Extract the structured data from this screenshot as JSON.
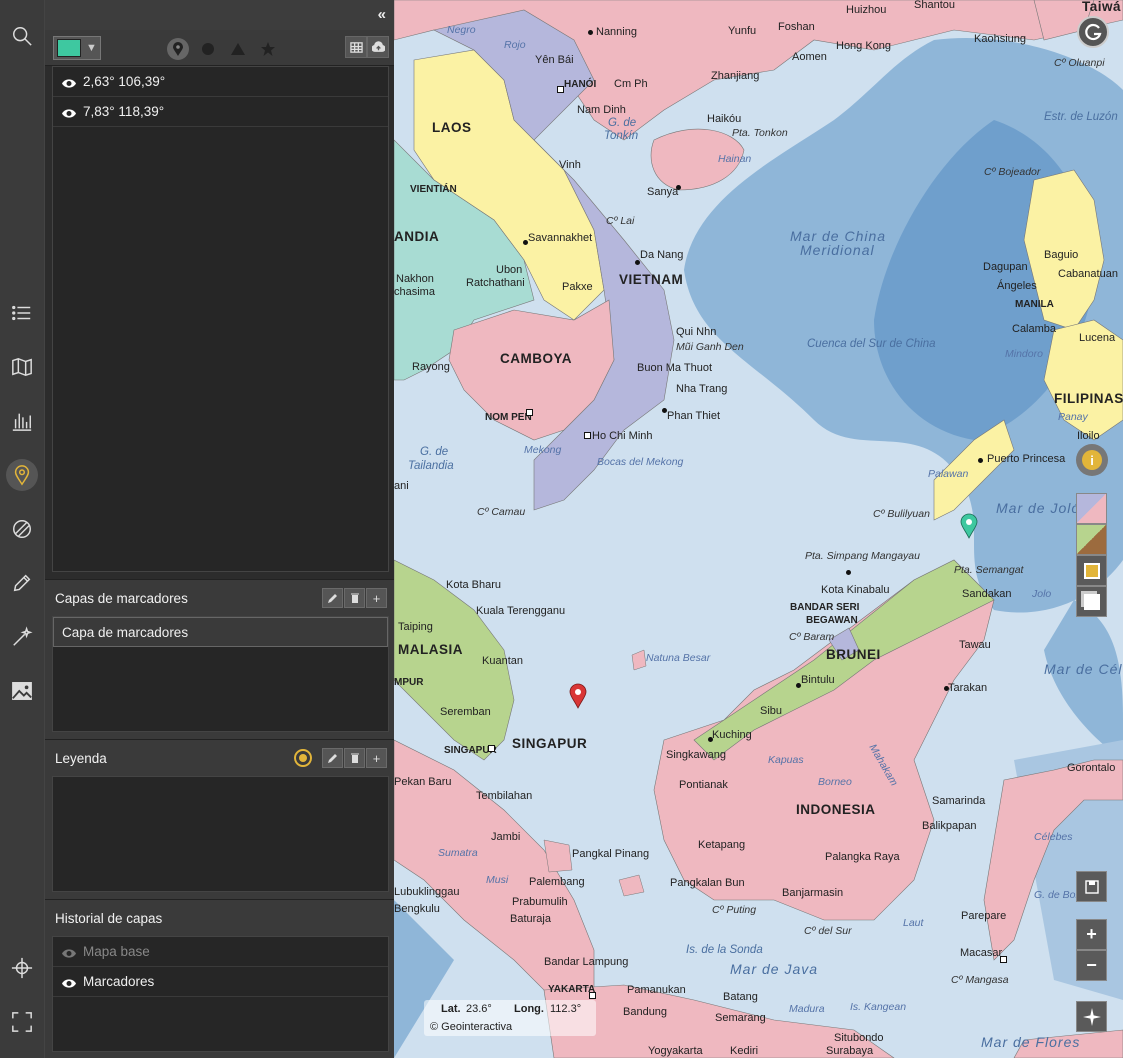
{
  "rail": {
    "icons": [
      "search-icon",
      "list-icon",
      "map-book-icon",
      "chart-bars-icon",
      "map-pin-icon",
      "compass-ruler-icon",
      "pencil-icon",
      "magic-wand-icon",
      "image-icon",
      "crosshair-icon",
      "fullscreen-icon"
    ],
    "active": "map-pin-icon",
    "active_color": "#e2b53a"
  },
  "toolbar": {
    "collapse_glyph": "«",
    "selected_color": "#3ec8a0",
    "shapes": [
      "pin-shape-icon",
      "circle-shape-icon",
      "triangle-shape-icon",
      "star-shape-icon"
    ],
    "buttons": [
      "table-icon",
      "cloud-upload-icon"
    ]
  },
  "markers": [
    {
      "label": "2,63° 106,39°"
    },
    {
      "label": "7,83° 118,39°"
    }
  ],
  "marker_layers": {
    "title": "Capas de marcadores",
    "items": [
      "Capa de marcadores"
    ]
  },
  "legend": {
    "title": "Leyenda"
  },
  "history": {
    "title": "Historial de capas",
    "items": [
      {
        "label": "Mapa base",
        "visible": false
      },
      {
        "label": "Marcadores",
        "visible": true
      }
    ]
  },
  "map": {
    "countries": [
      "LAOS",
      "VIETNAM",
      "CAMBOYA",
      "ANDIA",
      "MALASIA",
      "INDONESIA",
      "BRUNEI",
      "FILIPINAS",
      "SINGAPUR"
    ],
    "cities": [
      "Nanning",
      "Yunfu",
      "Foshan",
      "Huizhou",
      "Hong Kong",
      "Aomen",
      "Kaohsiung",
      "Yên Bái",
      "HANÓI",
      "Cm Ph",
      "Nam Dinh",
      "Zhanjiang",
      "Haikóu",
      "Pta. Tonkon",
      "Vinh",
      "Sanya",
      "VIENTIÁN",
      "Savannakhet",
      "Da Nang",
      "Nakhon",
      "chasima",
      "Ubon",
      "Ratchathani",
      "Pakxe",
      "Qui Nhn",
      "Mũi Ganh Den",
      "Buon Ma Thuot",
      "Nha Trang",
      "Phan Thiet",
      "Rayong",
      "NOM PEN",
      "Ho Chi Minh",
      "Bocas del Mekong",
      "ani",
      "Cº Camau",
      "Kota Bharu",
      "Kuala Terengganu",
      "Taiping",
      "Kuantan",
      "MPUR",
      "Seremban",
      "SINGAPUR",
      "Pekan Baru",
      "Tembilahan",
      "Jambi",
      "Pangkal Pinang",
      "Palembang",
      "Pangkalan Bun",
      "Singkawang",
      "Pontianak",
      "Kuching",
      "Sibu",
      "Bintulu",
      "Ketapang",
      "Banjarmasin",
      "Palangka Raya",
      "Samarinda",
      "Balikpapan",
      "Tarakan",
      "Tawau",
      "Sandakan",
      "Kota Kinabalu",
      "BANDAR SERI",
      "BEGAWAN",
      "Cº Baram",
      "Puerto Princesa",
      "Baguio",
      "Dagupan",
      "Cabanatuan",
      "Ángeles",
      "MANILA",
      "Calamba",
      "Lucena",
      "Iloilo",
      "Gorontalo",
      "Parepare",
      "Macasar",
      "Bandar Lampung",
      "YAKARTA",
      "Batang",
      "Semarang",
      "Bandung",
      "Pamanukan",
      "Yogyakarta",
      "Kediri",
      "Surabaya",
      "Situbondo",
      "Baturaja",
      "Prabumulih",
      "Lubuklinggau",
      "Bengkulu",
      "Cº Oluanpi",
      "Cº Bojeador",
      "Cº Lai",
      "Cº Bulilyuan",
      "Pta. Simpang Mangayau",
      "Pta. Semangat",
      "Cº Puting",
      "Cº del Sur",
      "Cº Mangasa"
    ],
    "seas": [
      "Mar de China Meridional",
      "Cuenca del Sur de China",
      "G. de Tonkín",
      "G. de Tailandia",
      "Natuna Besar",
      "Mar de Joló",
      "Mar de Célebes",
      "Mar de Java",
      "Is. de la Sonda",
      "Estr. de Luzón",
      "Mar de Flores",
      "Hainan",
      "Palawan",
      "Panay",
      "Mindoro",
      "Sumatra",
      "Borneo",
      "Kapuas",
      "Mahakam",
      "Laut",
      "Is. Kangean",
      "Madura",
      "Musi",
      "Mekong",
      "Negro",
      "Rojo",
      "Jolo",
      "Célebes",
      "G. de Boni",
      "Taiwá",
      "Shantou"
    ],
    "coords_lat_label": "Lat.",
    "coords_lat": "23.6°",
    "coords_long_label": "Long.",
    "coords_long": "112.3°",
    "credit": "© Geointeractiva",
    "controls": [
      "info-icon",
      "basemap-political-icon",
      "basemap-physical-icon",
      "layer-overlay-icon",
      "layer-stack-icon",
      "save-icon",
      "zoom-in-icon",
      "zoom-out-icon",
      "north-arrow-icon"
    ],
    "marker_colors": {
      "red": "#d93636",
      "teal": "#3ec8a0"
    }
  }
}
